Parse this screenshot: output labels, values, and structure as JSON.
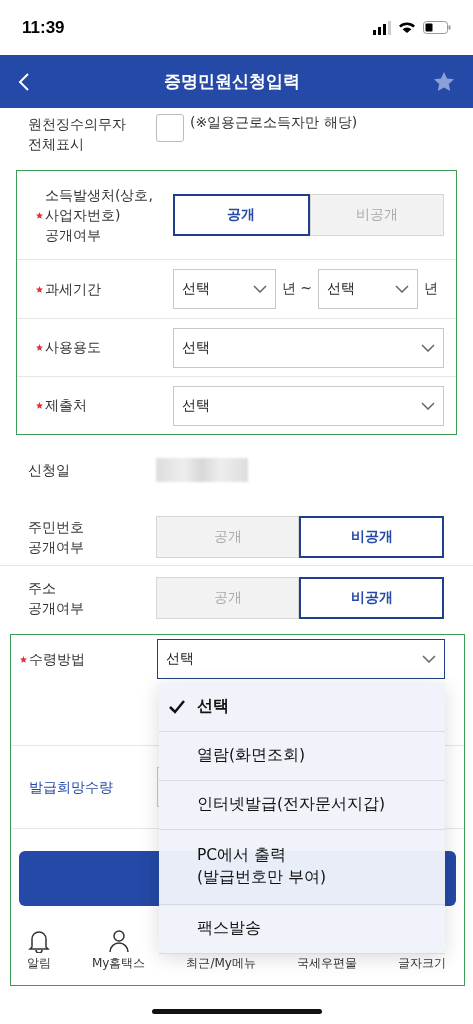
{
  "status_bar": {
    "time": "11:39"
  },
  "header": {
    "title": "증명민원신청입력"
  },
  "withholder_row": {
    "label": "원천징수의무자\n전체표시",
    "checked": false,
    "note": "(※일용근로소득자만 해당)"
  },
  "highlight_group_1": [
    {
      "kind": "toggle",
      "required": true,
      "label": "소득발생처(상호,\n사업자번호)\n공개여부",
      "options": [
        {
          "label": "공개",
          "selected": true
        },
        {
          "label": "비공개",
          "selected": false
        }
      ]
    },
    {
      "kind": "range",
      "required": true,
      "label": "과세기간",
      "from": "선택",
      "from_unit": "년 ~",
      "to": "선택",
      "to_unit": "년"
    },
    {
      "kind": "select",
      "required": true,
      "label": "사용용도",
      "value": "선택"
    },
    {
      "kind": "select",
      "required": true,
      "label": "제출처",
      "value": "선택"
    }
  ],
  "middle_rows": [
    {
      "kind": "blurred",
      "required": false,
      "label": "신청일"
    },
    {
      "kind": "toggle",
      "required": false,
      "label": "주민번호\n공개여부",
      "options": [
        {
          "label": "공개",
          "selected": false
        },
        {
          "label": "비공개",
          "selected": true
        }
      ]
    },
    {
      "kind": "toggle",
      "required": false,
      "label": "주소\n공개여부",
      "options": [
        {
          "label": "공개",
          "selected": false
        },
        {
          "label": "비공개",
          "selected": true
        }
      ]
    }
  ],
  "highlight_group_2": {
    "receive_label": "수령방법",
    "receive_required": true,
    "receive_value": "선택",
    "quantity_label": "발급희망수량",
    "dropdown": [
      {
        "label": "선택",
        "selected": true
      },
      {
        "label": "열람(화면조회)",
        "selected": false
      },
      {
        "label": "인터넷발급(전자문서지갑)",
        "selected": false
      },
      {
        "label": "PC에서 출력\n(발급번호만 부여)",
        "selected": false
      },
      {
        "label": "팩스발송",
        "selected": false
      }
    ]
  },
  "bottom_nav": [
    {
      "label": "알림",
      "kind": "bell"
    },
    {
      "label": "My홈택스",
      "kind": "person"
    },
    {
      "label": "최근/My메뉴",
      "kind": "none"
    },
    {
      "label": "국세우편물",
      "kind": "none"
    },
    {
      "label": "글자크기",
      "kind": "none"
    }
  ]
}
